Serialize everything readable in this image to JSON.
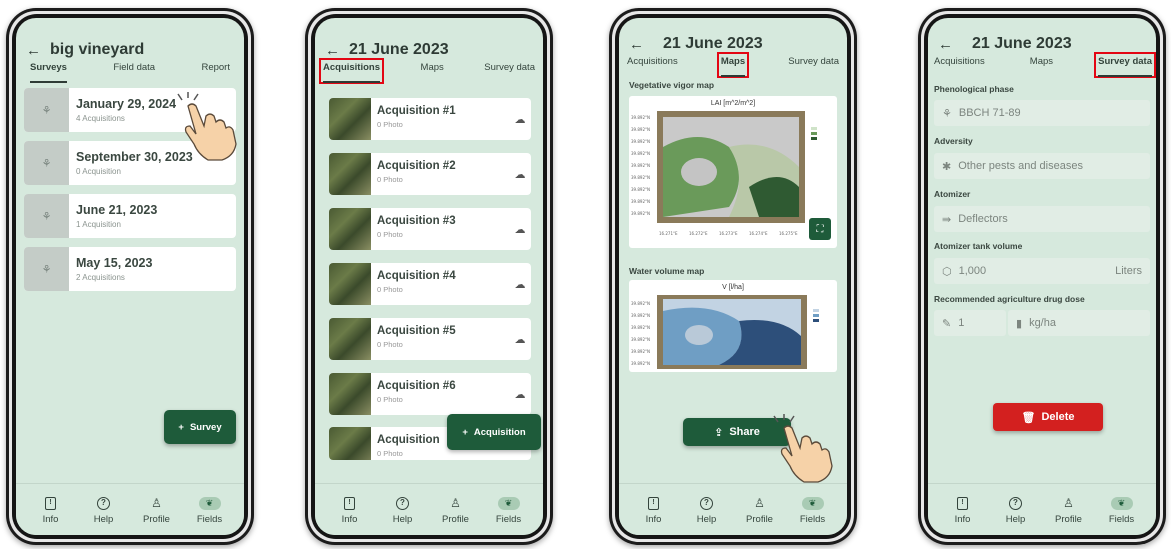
{
  "screen1": {
    "title": "big vineyard",
    "tabs": [
      "Surveys",
      "Field data",
      "Report"
    ],
    "surveys": [
      {
        "date": "January 29, 2024",
        "count": "4 Acquisitions"
      },
      {
        "date": "September 30, 2023",
        "count": "0 Acquisition"
      },
      {
        "date": "June 21, 2023",
        "count": "1 Acquisition"
      },
      {
        "date": "May 15, 2023",
        "count": "2 Acquisitions"
      }
    ],
    "fab_label": "Survey"
  },
  "screen2": {
    "title": "21 June 2023",
    "tabs": [
      "Acquisitions",
      "Maps",
      "Survey data"
    ],
    "acquisitions": [
      {
        "name": "Acquisition #1",
        "photos": "0 Photo"
      },
      {
        "name": "Acquisition #2",
        "photos": "0 Photo"
      },
      {
        "name": "Acquisition #3",
        "photos": "0 Photo"
      },
      {
        "name": "Acquisition #4",
        "photos": "0 Photo"
      },
      {
        "name": "Acquisition #5",
        "photos": "0 Photo"
      },
      {
        "name": "Acquisition #6",
        "photos": "0 Photo"
      },
      {
        "name": "Acquisition",
        "photos": "0 Photo"
      }
    ],
    "fab_label": "Acquisition"
  },
  "screen3": {
    "title": "21 June 2023",
    "tabs": [
      "Acquisitions",
      "Maps",
      "Survey data"
    ],
    "map1_section": "Vegetative vigor map",
    "map1_title": "LAI [m^2/m^2]",
    "map2_section": "Water volume map",
    "map2_title": "V [l/ha]",
    "share_label": "Share"
  },
  "screen4": {
    "title": "21 June 2023",
    "tabs": [
      "Acquisitions",
      "Maps",
      "Survey data"
    ],
    "fields": [
      {
        "label": "Phenological phase",
        "value": "BBCH 71-89",
        "icon": "plant-icon"
      },
      {
        "label": "Adversity",
        "value": "Other pests and diseases",
        "icon": "bug-icon"
      },
      {
        "label": "Atomizer",
        "value": "Deflectors",
        "icon": "deflector-icon"
      }
    ],
    "tank_label": "Atomizer tank volume",
    "tank_value": "1,000",
    "tank_unit": "Liters",
    "dose_label": "Recommended agriculture drug dose",
    "dose_value": "1",
    "dose_unit": "kg/ha",
    "delete_label": "Delete"
  },
  "nav": [
    "Info",
    "Help",
    "Profile",
    "Fields"
  ],
  "colors": {
    "accent": "#1e5b3a",
    "background": "#d6e9dd",
    "highlight": "#e30613",
    "danger": "#d3201f"
  }
}
